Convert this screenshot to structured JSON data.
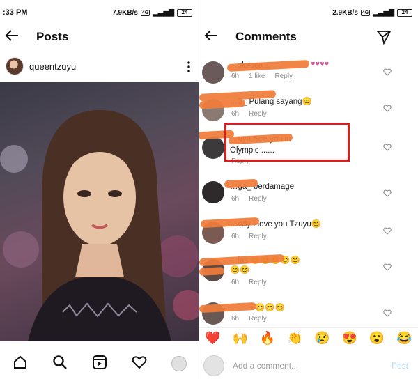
{
  "left": {
    "status": {
      "time": ":33 PM",
      "speed": "7.9KB/s",
      "network": "4G",
      "battery": "24"
    },
    "header": {
      "title": "Posts"
    },
    "post": {
      "username": "queentzuyu"
    }
  },
  "right": {
    "status": {
      "speed": "2.9KB/s",
      "network": "4G",
      "battery": "24"
    },
    "header": {
      "title": "Comments"
    },
    "comments": [
      {
        "text": "…slatcca…",
        "time": "6h",
        "likes": "1 like",
        "reply": "Reply"
      },
      {
        "text": "…3_ Pulang sayang😊",
        "time": "6h",
        "reply": "Reply"
      },
      {
        "text": "…nya See you in",
        "text2": "Olympic ......",
        "time": "",
        "reply": "Reply"
      },
      {
        "text": "…ga_ berdamage",
        "time": "6h",
        "reply": "Reply"
      },
      {
        "text": "…ndy I love you Tzuyu😊",
        "time": "6h",
        "reply": "Reply"
      },
      {
        "text": "…ias 😊😊😊😊😊",
        "text2": "😊😊",
        "time": "6h",
        "reply": "Reply"
      },
      {
        "text": "😊😊😊",
        "time": "6h",
        "reply": "Reply"
      }
    ],
    "emojis": [
      "❤️",
      "🙌",
      "🔥",
      "👏",
      "😢",
      "😍",
      "😮",
      "😂"
    ],
    "input": {
      "placeholder": "Add a comment...",
      "post_label": "Post"
    }
  },
  "colors": {
    "highlight": "#d62020",
    "scribble": "#f07c3a",
    "post_disabled": "#b2d7f5"
  }
}
